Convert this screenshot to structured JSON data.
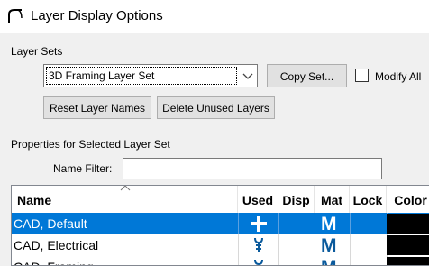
{
  "window": {
    "title": "Layer Display Options",
    "title_icon": "arc-icon"
  },
  "layer_sets": {
    "label": "Layer Sets",
    "selected": "3D Framing Layer Set",
    "copy_button": "Copy Set...",
    "modify_all_label": "Modify All",
    "modify_all_checked": false,
    "reset_button": "Reset Layer Names",
    "delete_button": "Delete Unused Layers"
  },
  "properties": {
    "label": "Properties for Selected Layer Set",
    "name_filter_label": "Name Filter:",
    "name_filter_value": ""
  },
  "table": {
    "columns": {
      "name": "Name",
      "used": "Used",
      "disp": "Disp",
      "mat": "Mat",
      "lock": "Lock",
      "color": "Color"
    },
    "rows": [
      {
        "name": "CAD,  Default",
        "used_icon": "plus-icon",
        "mat": "M",
        "color": "#000000",
        "selected": true
      },
      {
        "name": "CAD, Electrical",
        "used_icon": "wrench-icon",
        "mat": "M",
        "color": "#000000",
        "selected": false
      },
      {
        "name": "CAD, Framing",
        "used_icon": "wrench-icon",
        "mat": "M",
        "color": "#000000",
        "selected": false
      }
    ]
  },
  "colors": {
    "selection": "#0078d7",
    "material_icon": "#0a5a9c",
    "accent_text": "#0a5a9c"
  }
}
